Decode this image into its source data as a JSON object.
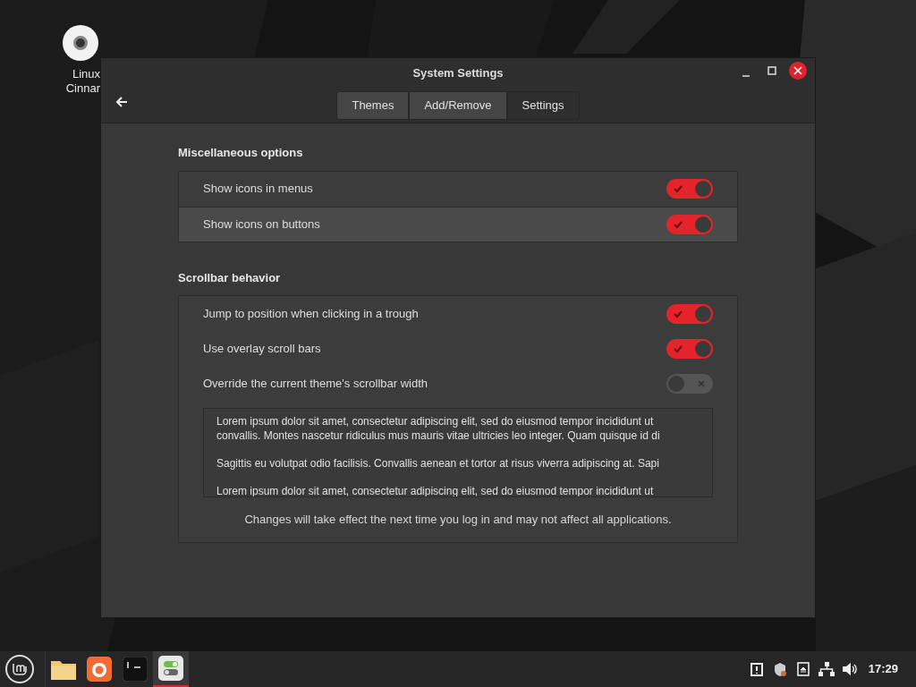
{
  "desktop_icons": [
    {
      "lines": [
        "Linux",
        "Cinnar"
      ]
    }
  ],
  "window": {
    "title": "System Settings",
    "tabs": [
      {
        "label": "Themes",
        "selected": false
      },
      {
        "label": "Add/Remove",
        "selected": false
      },
      {
        "label": "Settings",
        "selected": true
      }
    ],
    "sections": [
      {
        "title": "Miscellaneous options",
        "rows": [
          {
            "label": "Show icons in menus",
            "on": true,
            "hovered": false
          },
          {
            "label": "Show icons on buttons",
            "on": true,
            "hovered": true
          }
        ]
      },
      {
        "title": "Scrollbar behavior",
        "rows": [
          {
            "label": "Jump to position when clicking in a trough",
            "on": true,
            "hovered": false
          },
          {
            "label": "Use overlay scroll bars",
            "on": true,
            "hovered": false
          },
          {
            "label": "Override the current theme's scrollbar width",
            "on": false,
            "hovered": false
          }
        ],
        "text_view": {
          "paragraphs": [
            [
              "Lorem ipsum dolor sit amet, consectetur adipiscing elit, sed do eiusmod tempor incididunt ut",
              "convallis. Montes nascetur ridiculus mus mauris vitae ultricies leo integer. Quam quisque id di"
            ],
            [
              "Sagittis eu volutpat odio facilisis. Convallis aenean et tortor at risus viverra adipiscing at. Sapi"
            ],
            [
              "Lorem ipsum dolor sit amet, consectetur adipiscing elit, sed do eiusmod tempor incididunt ut"
            ]
          ]
        },
        "note": "Changes will take effect the next time you log in and may not affect all applications."
      }
    ]
  },
  "taskbar": {
    "launchers": [
      {
        "kind": "folder",
        "active": false
      },
      {
        "kind": "browser",
        "active": false
      },
      {
        "kind": "terminal",
        "active": false
      },
      {
        "kind": "settings",
        "active": true
      }
    ],
    "tray": [
      {
        "kind": "clipboard"
      },
      {
        "kind": "shield"
      },
      {
        "kind": "eject"
      },
      {
        "kind": "network"
      },
      {
        "kind": "volume"
      }
    ],
    "clock": "17:29"
  }
}
